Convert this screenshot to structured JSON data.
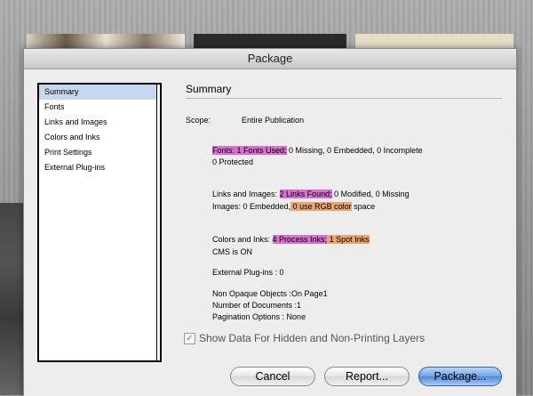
{
  "window": {
    "title": "Package"
  },
  "sidebar": {
    "items": [
      {
        "label": "Summary"
      },
      {
        "label": "Fonts"
      },
      {
        "label": "Links and Images"
      },
      {
        "label": "Colors and Inks"
      },
      {
        "label": "Print Settings"
      },
      {
        "label": "External Plug-ins"
      }
    ]
  },
  "summary": {
    "heading": "Summary",
    "scope_label": "Scope:",
    "scope_value": "Entire Publication",
    "fonts": {
      "highlight": "Fonts: 1 Fonts Used;",
      "rest": " 0 Missing, 0 Embedded, 0 Incomplete",
      "line2": "0 Protected"
    },
    "links": {
      "prefix": "Links and Images: ",
      "highlight": "2 Links Found;",
      "rest": " 0 Modified, 0 Missing",
      "line2_prefix": "Images: 0 Embedded,",
      "line2_highlight": " 0 use RGB color",
      "line2_rest": " space"
    },
    "colors": {
      "prefix": "Colors and Inks: ",
      "highlight1": "4 Process Inks;",
      "highlight2": " 1 Spot Inks",
      "line2": "CMS is ON"
    },
    "plugins": "External Plug-ins : 0",
    "non_opaque": "Non Opaque Objects :On Page1",
    "num_docs": "Number of Documents :1",
    "pagination": "Pagination Options : None"
  },
  "checkbox": {
    "label": "Show Data For Hidden and Non-Printing Layers",
    "checked_glyph": "✓"
  },
  "buttons": {
    "cancel": "Cancel",
    "report": "Report...",
    "package": "Package..."
  },
  "colors": {
    "highlight_pink": "#d96fce",
    "highlight_orange": "#e9a66e",
    "selection": "#c6d8f0",
    "default_button": "#6ea3e6"
  }
}
